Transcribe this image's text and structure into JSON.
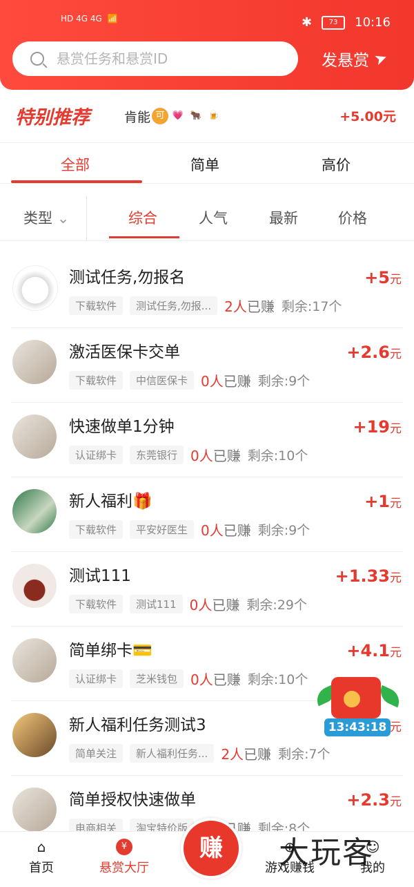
{
  "status": {
    "left": "HD 4G 4G",
    "battery": "73",
    "time": "10:16"
  },
  "header": {
    "search_placeholder": "悬赏任务和悬赏ID",
    "publish_label": "发悬赏"
  },
  "special": {
    "title": "特别推荐",
    "user": "肯能",
    "price": "+5.00元"
  },
  "tabs": [
    "全部",
    "简单",
    "高价"
  ],
  "filter": {
    "type_label": "类型",
    "options": [
      "综合",
      "人气",
      "最新",
      "价格"
    ]
  },
  "tasks": [
    {
      "title": "测试任务,勿报名",
      "price": "+5",
      "tag1": "下载软件",
      "tag2": "测试任务,勿报...",
      "earned_num": "2人",
      "earned_text": "已赚",
      "remaining": "剩余:17个"
    },
    {
      "title": "激活医保卡交单",
      "price": "+2.6",
      "tag1": "下载软件",
      "tag2": "中信医保卡",
      "earned_num": "0人",
      "earned_text": "已赚",
      "remaining": "剩余:9个"
    },
    {
      "title": "快速做单1分钟",
      "price": "+19",
      "tag1": "认证绑卡",
      "tag2": "东莞银行",
      "earned_num": "0人",
      "earned_text": "已赚",
      "remaining": "剩余:10个"
    },
    {
      "title": "新人福利🎁",
      "price": "+1",
      "tag1": "下载软件",
      "tag2": "平安好医生",
      "earned_num": "0人",
      "earned_text": "已赚",
      "remaining": "剩余:9个"
    },
    {
      "title": "测试111",
      "price": "+1.33",
      "tag1": "下载软件",
      "tag2": "测试111",
      "earned_num": "0人",
      "earned_text": "已赚",
      "remaining": "剩余:29个"
    },
    {
      "title": "简单绑卡💳",
      "price": "+4.1",
      "tag1": "认证绑卡",
      "tag2": "芝米钱包",
      "earned_num": "0人",
      "earned_text": "已赚",
      "remaining": "剩余:10个"
    },
    {
      "title": "新人福利任务测试3",
      "price": "",
      "tag1": "简单关注",
      "tag2": "新人福利任务...",
      "earned_num": "2人",
      "earned_text": "已赚",
      "remaining": "剩余:7个"
    },
    {
      "title": "简单授权快速做单",
      "price": "+2.3",
      "tag1": "电商相关",
      "tag2": "淘宝特价版",
      "earned_num": "0人",
      "earned_text": "已赚",
      "remaining": "剩余:8个"
    }
  ],
  "price_unit": "元",
  "timer": "13:43:18",
  "nav": [
    "首页",
    "悬赏大厅",
    "赚",
    "游戏赚钱",
    "我的"
  ],
  "watermark": "大玩客",
  "colors": {
    "primary": "#e43a2f",
    "header": "#f2372d"
  }
}
